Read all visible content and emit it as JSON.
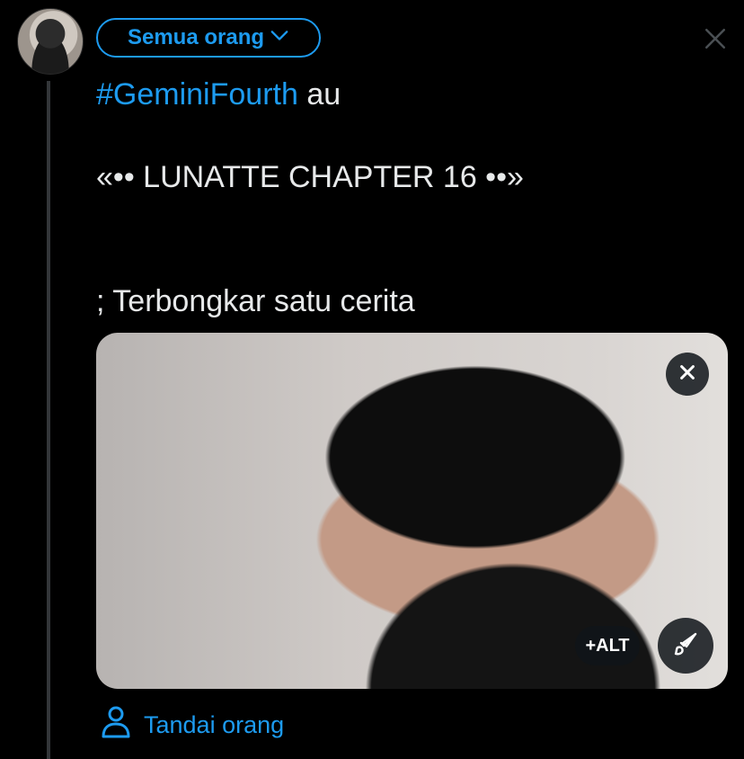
{
  "header": {
    "audience_label": "Semua orang",
    "close_icon": "close-icon",
    "chevron_icon": "chevron-down-icon"
  },
  "tweet": {
    "lines": [
      {
        "hashtag": "#GeminiFourth",
        "text": " au"
      },
      {
        "text": ""
      },
      {
        "text": "«•• LUNATTE CHAPTER 16 ••»"
      },
      {
        "text": ""
      },
      {
        "text": ""
      },
      {
        "text": "; Terbongkar satu cerita"
      }
    ]
  },
  "media": {
    "alt_label": "+ALT",
    "remove_icon": "close-icon",
    "edit_icon": "brush-icon"
  },
  "tag_people": {
    "label": "Tandai orang",
    "icon": "person-icon"
  },
  "colors": {
    "accent": "#1d9bf0",
    "background": "#000000",
    "text": "#e7e9ea",
    "thread_line": "#333639"
  }
}
